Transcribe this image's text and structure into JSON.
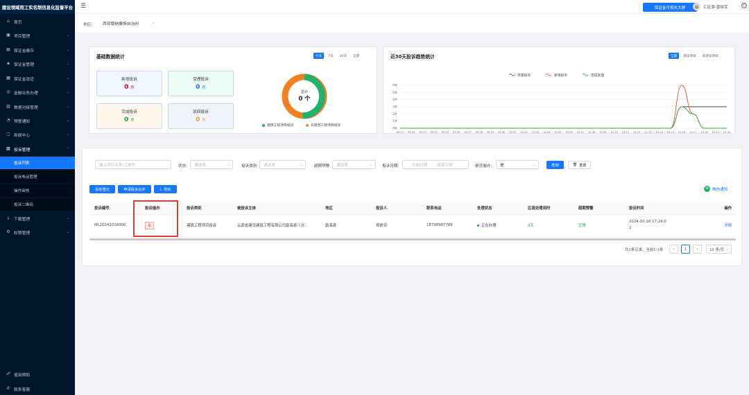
{
  "app": {
    "title": "建设领域用工实名制信息化监督平台"
  },
  "sidebar": {
    "items": [
      {
        "label": "首页",
        "icon": "home-icon",
        "glyph": "⌂",
        "arrow": "",
        "top": 22
      },
      {
        "label": "项目管理",
        "icon": "project-icon",
        "glyph": "▣",
        "arrow": "⌄",
        "top": 42
      },
      {
        "label": "保证金缴存",
        "icon": "deposit-icon",
        "glyph": "▤",
        "arrow": "⌄",
        "top": 63
      },
      {
        "label": "保证金管理",
        "icon": "manage-icon",
        "glyph": "◈",
        "arrow": "⌄",
        "top": 83
      },
      {
        "label": "保证金退还",
        "icon": "refund-icon",
        "glyph": "▦",
        "arrow": "⌄",
        "top": 104
      },
      {
        "label": "金融业务办理",
        "icon": "finance-icon",
        "glyph": "◎",
        "arrow": "⌄",
        "top": 124
      },
      {
        "label": "数据对接管理",
        "icon": "data-icon",
        "glyph": "▥",
        "arrow": "⌄",
        "top": 145
      },
      {
        "label": "预警通知",
        "icon": "bell-icon",
        "glyph": "◔",
        "arrow": "⌄",
        "top": 165
      },
      {
        "label": "新闻中心",
        "icon": "news-icon",
        "glyph": "▢",
        "arrow": "⌄",
        "top": 185
      },
      {
        "label": "投诉管理",
        "icon": "complaint-icon",
        "glyph": "▧",
        "arrow": "⌃",
        "top": 206
      }
    ],
    "subitems": [
      {
        "label": "投诉列表",
        "active": true
      },
      {
        "label": "投诉电话管理",
        "active": false
      },
      {
        "label": "操作审核",
        "active": false
      },
      {
        "label": "投诉二维码",
        "active": false
      }
    ],
    "after": [
      {
        "label": "下载管理",
        "icon": "download-icon",
        "glyph": "⤓",
        "arrow": "⌄",
        "top": 306
      },
      {
        "label": "权限管理",
        "icon": "permission-icon",
        "glyph": "⚙",
        "arrow": "⌄",
        "top": 326
      }
    ],
    "bottom": [
      {
        "label": "使用帮助",
        "icon": "help-icon",
        "glyph": "☍",
        "top": 531
      },
      {
        "label": "联系客服",
        "icon": "service-icon",
        "glyph": "✆",
        "top": 552
      }
    ]
  },
  "header": {
    "big_screen_button": "保证金可视化大屏",
    "user_name": "汇臣源-曾晓军"
  },
  "region": {
    "label": "地区:",
    "value": "西双版纳傣族自治州"
  },
  "stats_card": {
    "title": "基础数据统计",
    "tabs": [
      {
        "label": "今天",
        "on": true
      },
      {
        "label": "7天",
        "on": false
      },
      {
        "label": "30天",
        "on": false
      },
      {
        "label": "全部",
        "on": false
      }
    ],
    "boxes": [
      {
        "label": "新增投诉",
        "value": "0",
        "unit": "件",
        "color": "#d9001b",
        "bg": "#f0f7ff"
      },
      {
        "label": "受理投诉",
        "value": "0",
        "unit": "件",
        "color": "#1677ff",
        "bg": "#eefbf4"
      },
      {
        "label": "完成投诉",
        "value": "0",
        "unit": "件",
        "color": "#17a34a",
        "bg": "#fff7ec"
      },
      {
        "label": "驳回投诉",
        "value": "0",
        "unit": "件",
        "color": "#f0a020",
        "bg": "#f1f3fb"
      }
    ],
    "donut": {
      "center_label": "总计",
      "center_value": "0 个"
    },
    "legend": [
      {
        "label": "建筑工程项目投诉",
        "color": "#21b36b"
      },
      {
        "label": "非建筑工程项目投诉",
        "color": "#f38020"
      }
    ]
  },
  "trend_card": {
    "title": "近30天投诉趋势统计",
    "tabs": [
      {
        "label": "全部",
        "on": true
      },
      {
        "label": "建设领域",
        "on": false
      },
      {
        "label": "非建设领域",
        "on": false
      }
    ],
    "legend": [
      {
        "label": "存量投诉",
        "color": "#444444"
      },
      {
        "label": "新增投诉",
        "color": "#e04b3a"
      },
      {
        "label": "完成处理",
        "color": "#3aa53a"
      }
    ]
  },
  "chart_data": {
    "type": "line",
    "title": "近30天投诉趋势统计",
    "x": [
      "09-21",
      "09-22",
      "09-23",
      "09-24",
      "09-25",
      "09-26",
      "09-27",
      "09-28",
      "09-29",
      "09-30",
      "10-01",
      "10-02",
      "10-03",
      "10-04",
      "10-05",
      "10-06",
      "10-07",
      "10-08",
      "10-09",
      "10-10",
      "10-11",
      "10-12",
      "10-13",
      "10-14",
      "10-15",
      "10-16",
      "10-17",
      "10-18",
      "10-19",
      "10-20"
    ],
    "yticks": [
      "0件",
      "1件",
      "2件",
      "3件",
      "4件",
      "5件",
      "6件"
    ],
    "ylim": [
      0,
      6
    ],
    "series": [
      {
        "name": "存量投诉",
        "color": "#444444",
        "values": [
          0,
          0,
          0,
          0,
          0,
          0,
          0,
          0,
          0,
          0,
          0,
          0,
          0,
          0,
          0,
          0,
          0,
          0,
          0,
          0,
          0,
          0,
          0,
          0,
          0,
          3,
          3,
          3,
          3,
          3
        ]
      },
      {
        "name": "新增投诉",
        "color": "#e04b3a",
        "values": [
          0,
          0,
          0,
          0,
          0,
          0,
          0,
          0,
          0,
          0,
          0,
          0,
          0,
          0,
          0,
          0,
          0,
          0,
          0,
          0,
          0,
          0,
          0,
          0,
          0,
          6,
          2,
          0,
          0,
          0
        ]
      },
      {
        "name": "完成处理",
        "color": "#3aa53a",
        "values": [
          0,
          0,
          0,
          0,
          0,
          0,
          0,
          0,
          0,
          0,
          0,
          0,
          0,
          0,
          0,
          0,
          0,
          0,
          0,
          0,
          0,
          0,
          0,
          0,
          0,
          3,
          2,
          0,
          0,
          0
        ]
      }
    ]
  },
  "filters": {
    "keyword_placeholder": "输入项目名称/工单号",
    "status_label": "状态:",
    "status_placeholder": "请选择",
    "type_label": "投诉类别:",
    "type_placeholder": "请选择",
    "warning_label": "超期预警:",
    "warning_placeholder": "请选择",
    "date_label": "投诉日期:",
    "date_start": "开始日期",
    "date_sep": "-",
    "date_end": "结束日期",
    "need_label": "是否催办:",
    "need_value": "是",
    "search_button": "查询",
    "reset_button": "重置"
  },
  "actions": {
    "register_button": "投诉登记",
    "apply_button": "申请投诉合并",
    "export_button": "导出",
    "wechat_label": "微信通知"
  },
  "table": {
    "headers": [
      "投诉编号",
      "投诉催办",
      "投诉类别",
      "被投诉主体",
      "地区",
      "投诉人",
      "联系电话",
      "处理状态",
      "区县处理用时",
      "超期预警",
      "投诉时间",
      "操作"
    ],
    "rows": [
      {
        "id": "ML20241016006",
        "urge": "是",
        "category": "建筑工程项目投诉",
        "subject": "云南省建设建筑工程有限公司勐海县八分...",
        "region": "勐海县",
        "person": "郑娇安",
        "phone": "18798987788",
        "status": "正在办理",
        "duration": "3天",
        "warning": "正常",
        "time_a": "2024-10-16 17:29:0",
        "time_b": "2",
        "action": "详情"
      }
    ]
  },
  "pagination": {
    "summary": "共1条记录，当前1-1条",
    "prev": "‹",
    "current": "1",
    "next": "›",
    "page_size": "10 条/页"
  }
}
